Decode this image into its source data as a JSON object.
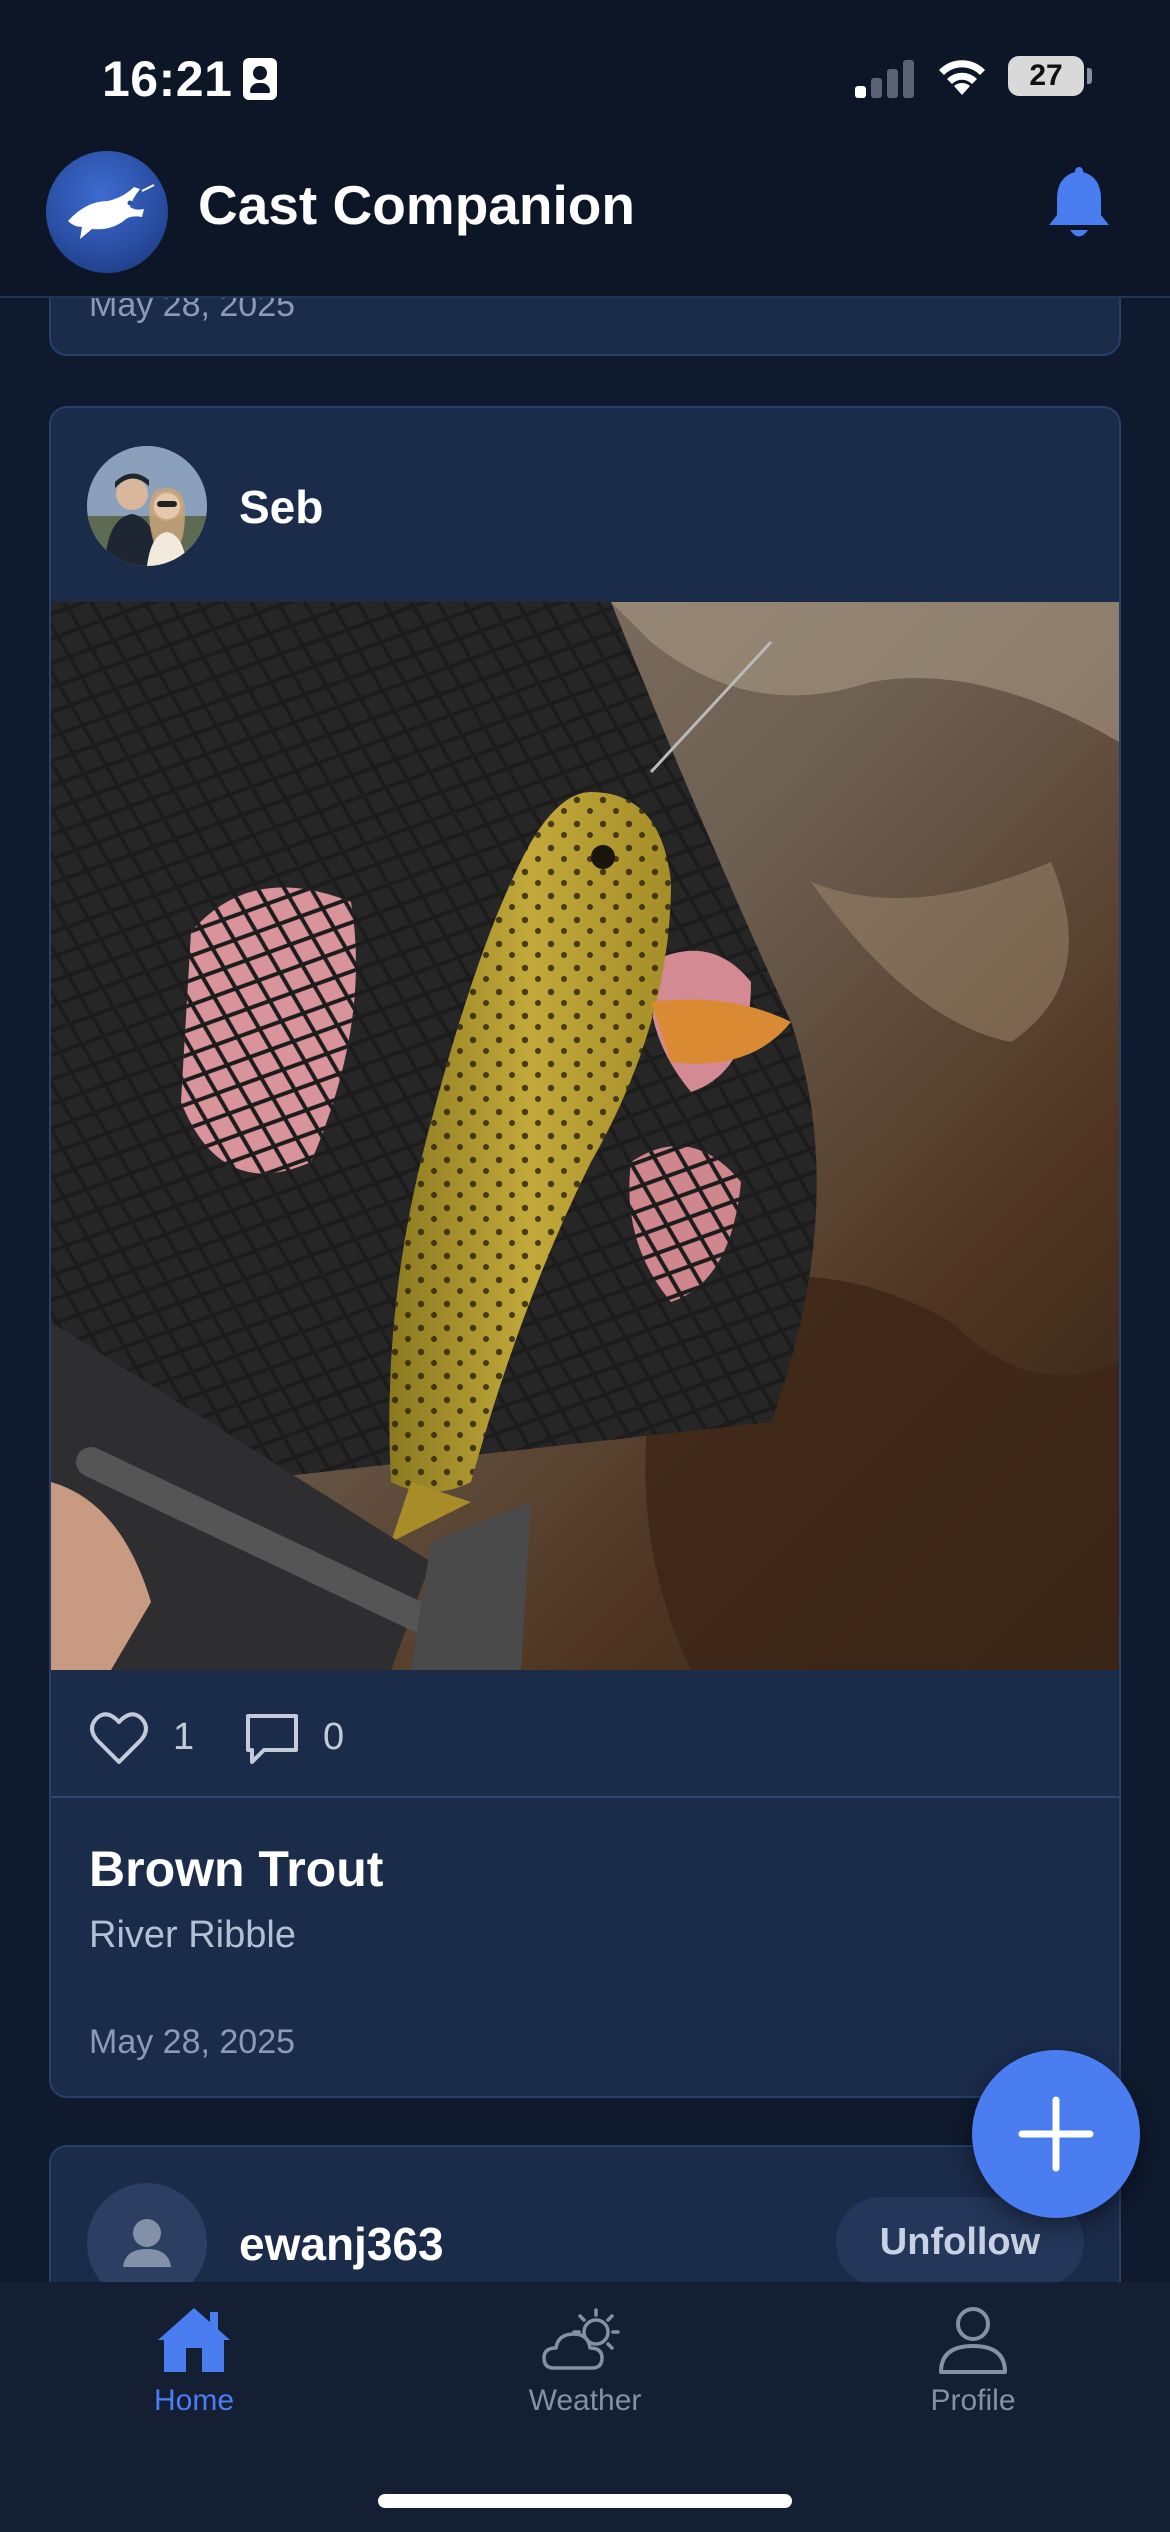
{
  "status_bar": {
    "time": "16:21",
    "battery": "27"
  },
  "header": {
    "title": "Cast Companion",
    "logo_icon": "fish-logo-icon",
    "notification_icon": "bell-icon",
    "accent_color": "#4a7df0"
  },
  "feed": {
    "previous_post": {
      "date": "May 28, 2025"
    },
    "post": {
      "username": "Seb",
      "photo": "brown trout in landing net over river water",
      "likes": "1",
      "comments": "0",
      "species": "Brown Trout",
      "location": "River Ribble",
      "date": "May 28, 2025"
    },
    "next_post": {
      "username": "ewanj363",
      "follow_button": "Unfollow"
    }
  },
  "fab": {
    "icon": "plus-icon"
  },
  "tab_bar": {
    "tabs": [
      {
        "label": "Home",
        "icon": "home-icon",
        "active": true
      },
      {
        "label": "Weather",
        "icon": "cloud-sun-icon",
        "active": false
      },
      {
        "label": "Profile",
        "icon": "person-icon",
        "active": false
      }
    ]
  }
}
